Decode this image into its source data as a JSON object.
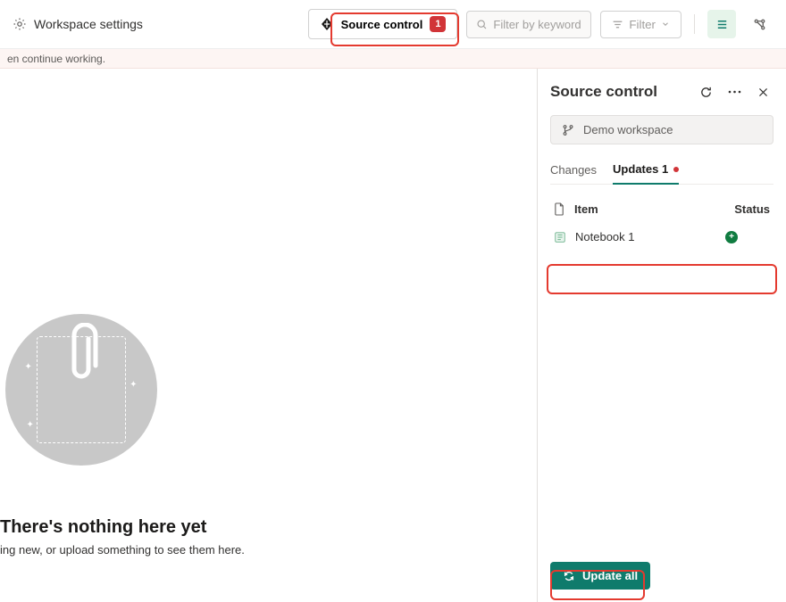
{
  "toolbar": {
    "workspace_settings": "Workspace settings",
    "source_control_label": "Source control",
    "source_control_badge": "1",
    "filter_placeholder": "Filter by keyword",
    "filter_button": "Filter"
  },
  "notice": {
    "text_fragment": "en continue working."
  },
  "empty": {
    "title": "There's nothing here yet",
    "subtitle_fragment": "ing new, or upload something to see them here."
  },
  "panel": {
    "title": "Source control",
    "branch": "Demo workspace",
    "tabs": {
      "changes": "Changes",
      "updates": "Updates 1"
    },
    "columns": {
      "item": "Item",
      "status": "Status"
    },
    "rows": [
      {
        "name": "Notebook 1",
        "status": "added"
      }
    ],
    "update_all": "Update all"
  }
}
